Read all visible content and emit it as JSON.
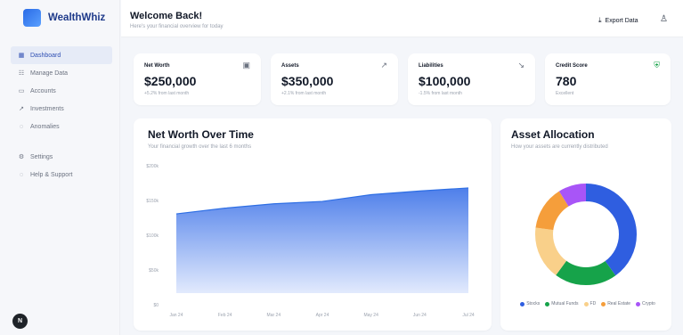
{
  "app": {
    "name": "WealthWhiz"
  },
  "sidebar": {
    "items": [
      {
        "label": "Dashboard",
        "icon": "grid-icon",
        "glyph": "▦"
      },
      {
        "label": "Manage Data",
        "icon": "table-icon",
        "glyph": "☷"
      },
      {
        "label": "Accounts",
        "icon": "card-icon",
        "glyph": "▭"
      },
      {
        "label": "Investments",
        "icon": "trend-icon",
        "glyph": "↗"
      },
      {
        "label": "Anomalies",
        "icon": "alert-icon",
        "glyph": "◌"
      }
    ],
    "secondary": [
      {
        "label": "Settings",
        "icon": "gear-icon",
        "glyph": "⚙"
      },
      {
        "label": "Help & Support",
        "icon": "help-icon",
        "glyph": "◌"
      }
    ],
    "user_initial": "N"
  },
  "header": {
    "title": "Welcome Back!",
    "subtitle": "Here's your financial overview for today",
    "export_label": "Export Data"
  },
  "stats": [
    {
      "label": "Net Worth",
      "value": "$250,000",
      "sub": "+5.2% from last month",
      "icon": "calendar-icon",
      "glyph": "▣"
    },
    {
      "label": "Assets",
      "value": "$350,000",
      "sub": "+2.1% from last month",
      "icon": "trend-up-icon",
      "glyph": "↗"
    },
    {
      "label": "Liabilities",
      "value": "$100,000",
      "sub": "-1.5% from last month",
      "icon": "trend-down-icon",
      "glyph": "↘"
    },
    {
      "label": "Credit Score",
      "value": "780",
      "sub": "Excellent",
      "icon": "shield-icon",
      "glyph": "⛨"
    }
  ],
  "networth_panel": {
    "title": "Net Worth Over Time",
    "subtitle": "Your financial growth over the last 6 months"
  },
  "allocation_panel": {
    "title": "Asset Allocation",
    "subtitle": "How your assets are currently distributed"
  },
  "colors": {
    "accent": "#2f6fe4",
    "area_top": "#4e7fea",
    "area_bottom": "#e2eafd"
  },
  "chart_data": [
    {
      "type": "area",
      "x": [
        "Jan 24",
        "Feb 24",
        "Mar 24",
        "Apr 24",
        "May 24",
        "Jun 24",
        "Jul 24"
      ],
      "values": [
        235,
        252,
        265,
        272,
        292,
        303,
        312
      ],
      "y_ticks": [
        "$0",
        "$50k",
        "$100k",
        "$150k",
        "$200k"
      ],
      "ylim": [
        0,
        370
      ],
      "grid": false
    },
    {
      "type": "pie",
      "legend_position": "bottom",
      "series": [
        {
          "name": "Stocks",
          "value": 40,
          "color": "#2f5ee0"
        },
        {
          "name": "Mutual Funds",
          "value": 20,
          "color": "#16a34a"
        },
        {
          "name": "FD",
          "value": 17,
          "color": "#f9d08a"
        },
        {
          "name": "Real Estate",
          "value": 14,
          "color": "#f59e3b"
        },
        {
          "name": "Crypto",
          "value": 9,
          "color": "#a855f7"
        }
      ]
    }
  ]
}
